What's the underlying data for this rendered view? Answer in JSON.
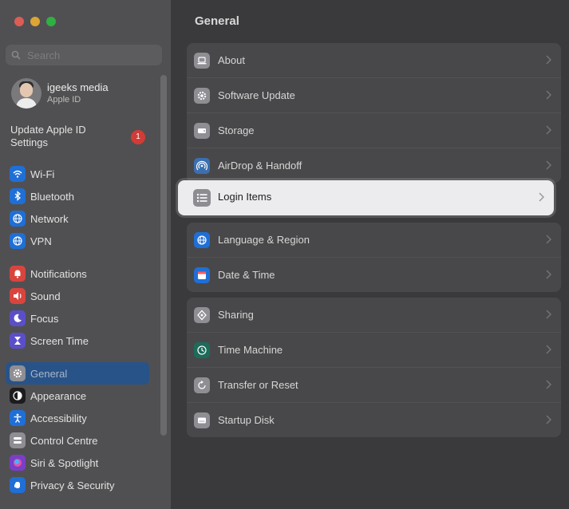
{
  "search": {
    "placeholder": "Search"
  },
  "account": {
    "name": "igeeks media",
    "subtitle": "Apple ID"
  },
  "update": {
    "label": "Update Apple ID Settings",
    "badge": "1"
  },
  "sidebar": {
    "groups": [
      [
        {
          "label": "Wi-Fi",
          "icon": "wifi-icon",
          "color": "#1f6fd6"
        },
        {
          "label": "Bluetooth",
          "icon": "bluetooth-icon",
          "color": "#1f6fd6"
        },
        {
          "label": "Network",
          "icon": "globe-icon",
          "color": "#1f6fd6"
        },
        {
          "label": "VPN",
          "icon": "globe-icon",
          "color": "#1f6fd6"
        }
      ],
      [
        {
          "label": "Notifications",
          "icon": "bell-icon",
          "color": "#d8453e"
        },
        {
          "label": "Sound",
          "icon": "speaker-icon",
          "color": "#d8453e"
        },
        {
          "label": "Focus",
          "icon": "moon-icon",
          "color": "#5b4fc9"
        },
        {
          "label": "Screen Time",
          "icon": "hourglass-icon",
          "color": "#5b4fc9"
        }
      ],
      [
        {
          "label": "General",
          "icon": "gear-icon",
          "color": "#8e8e93",
          "active": true
        },
        {
          "label": "Appearance",
          "icon": "appearance-icon",
          "color": "#1c1c1e"
        },
        {
          "label": "Accessibility",
          "icon": "accessibility-icon",
          "color": "#1f6fd6"
        },
        {
          "label": "Control Centre",
          "icon": "control-centre-icon",
          "color": "#8e8e93"
        },
        {
          "label": "Siri & Spotlight",
          "icon": "siri-icon",
          "color": "#7a3fc7"
        },
        {
          "label": "Privacy & Security",
          "icon": "hand-icon",
          "color": "#1f6fd6"
        }
      ]
    ]
  },
  "main": {
    "title": "General",
    "groups": [
      [
        {
          "label": "About",
          "icon": "laptop-icon",
          "color": "#8e8e93"
        },
        {
          "label": "Software Update",
          "icon": "gear-icon",
          "color": "#8e8e93"
        },
        {
          "label": "Storage",
          "icon": "storage-icon",
          "color": "#8e8e93"
        },
        {
          "label": "AirDrop & Handoff",
          "icon": "airdrop-icon",
          "color": "#3b6fb0"
        }
      ],
      [
        {
          "label": "Language & Region",
          "icon": "globe-icon",
          "color": "#1f6fd6"
        },
        {
          "label": "Date & Time",
          "icon": "calendar-icon",
          "color": "#1f6fd6"
        }
      ],
      [
        {
          "label": "Sharing",
          "icon": "sharing-icon",
          "color": "#8e8e93"
        },
        {
          "label": "Time Machine",
          "icon": "time-machine-icon",
          "color": "#1d6b5a"
        },
        {
          "label": "Transfer or Reset",
          "icon": "reset-icon",
          "color": "#8e8e93"
        },
        {
          "label": "Startup Disk",
          "icon": "disk-icon",
          "color": "#8e8e93"
        }
      ]
    ],
    "highlighted": {
      "label": "Login Items",
      "icon": "list-icon",
      "color": "#8d8d91"
    }
  }
}
